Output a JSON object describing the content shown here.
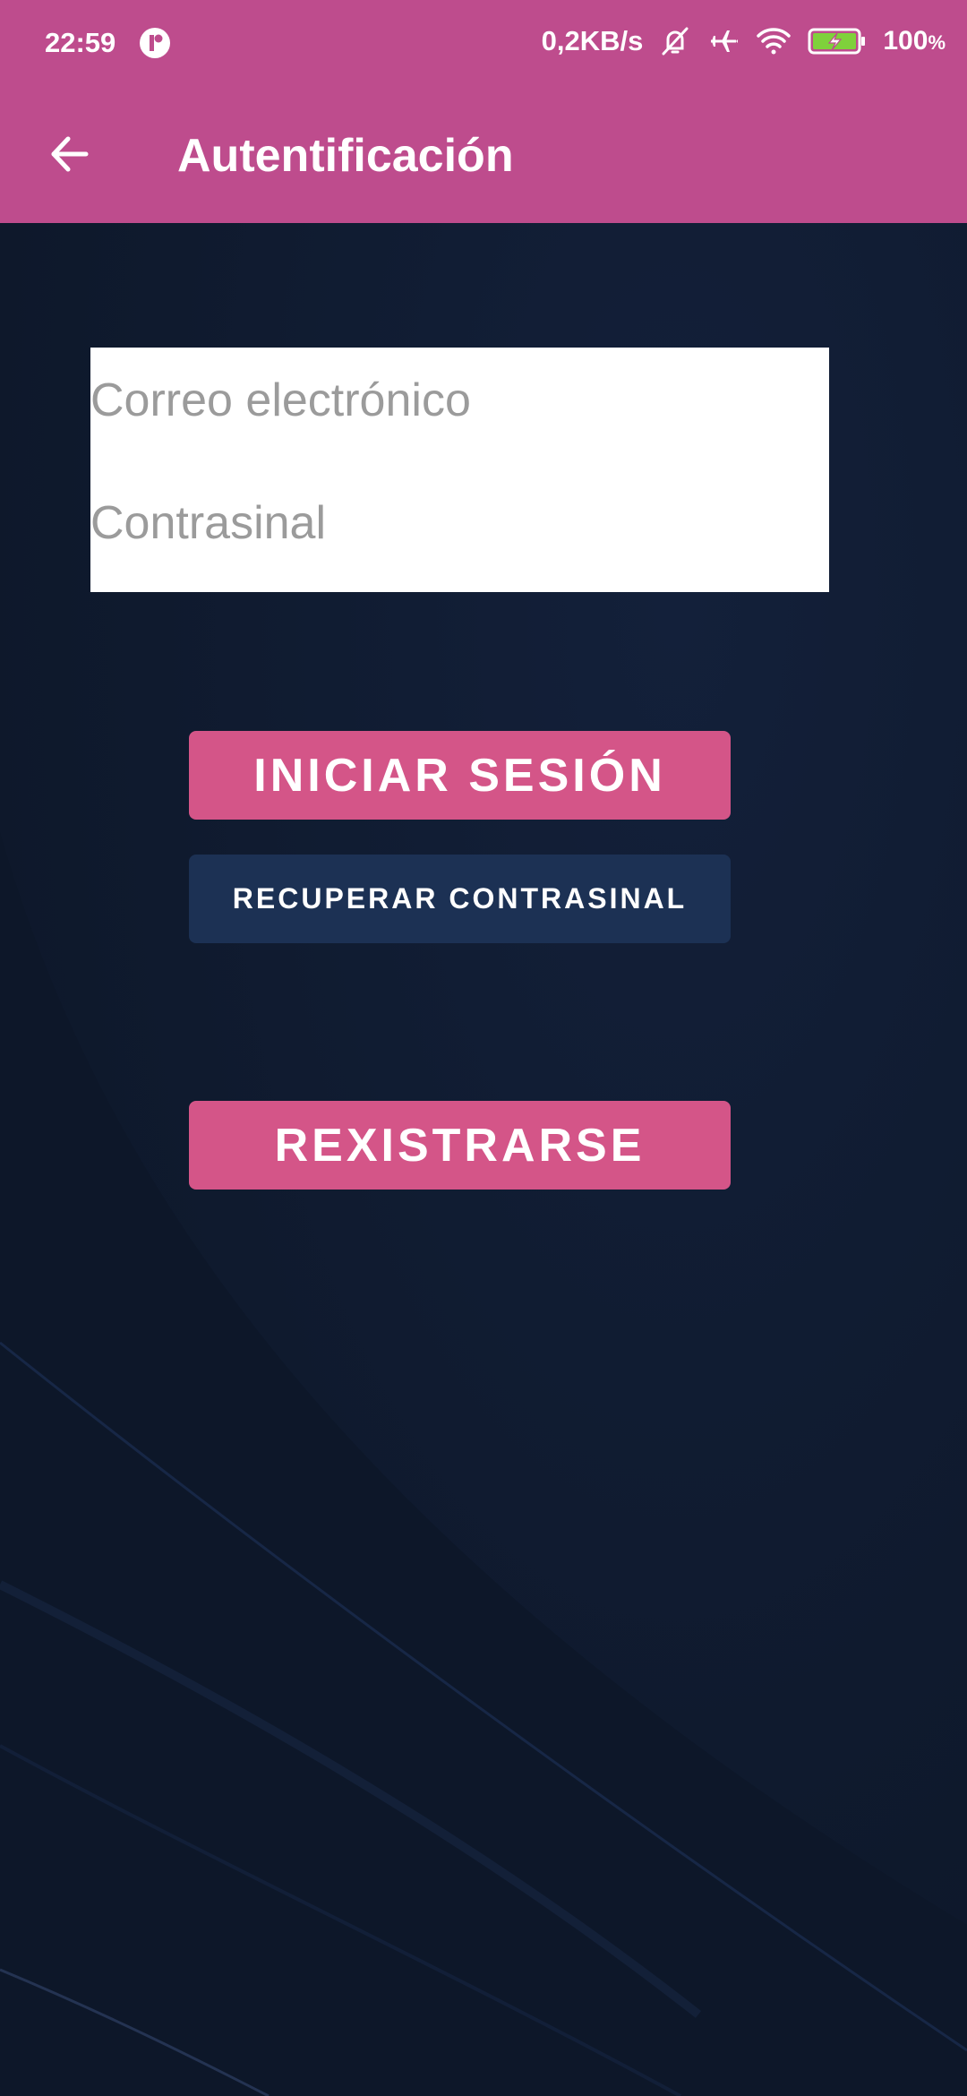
{
  "status_bar": {
    "time": "22:59",
    "network_speed": "0,2KB/s",
    "battery_percent": "100",
    "battery_unit": "%"
  },
  "toolbar": {
    "title": "Autentificación",
    "back_icon": "arrow-left-icon"
  },
  "form": {
    "email_placeholder": "Correo electrónico",
    "password_placeholder": "Contrasinal"
  },
  "buttons": {
    "login_label": "INICIAR SESIÓN",
    "recover_label": "RECUPERAR CONTRASINAL",
    "register_label": "REXISTRARSE"
  },
  "colors": {
    "app_bar": "#be4c8d",
    "primary_button": "#d45588",
    "secondary_button": "#1c3154",
    "background": "#0f1a2d"
  }
}
